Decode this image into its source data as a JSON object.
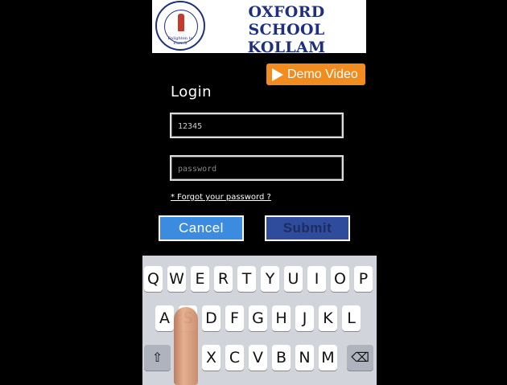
{
  "header": {
    "school_name": "OXFORD SCHOOL KOLLAM",
    "crest_motto": "Enlighten to Enrich",
    "crest_icon": "school-crest-icon"
  },
  "demo": {
    "label": "Demo Video",
    "icon": "play-icon",
    "color": "#f28c1e"
  },
  "login": {
    "title": "Login",
    "username_value": "12345",
    "password_placeholder": "password",
    "forgot_label": "* Forgot your password ?",
    "cancel_label": "Cancel",
    "submit_label": "Submit"
  },
  "keyboard": {
    "row1": [
      "Q",
      "W",
      "E",
      "R",
      "T",
      "Y",
      "U",
      "I",
      "O",
      "P"
    ],
    "row2": [
      "A",
      "S",
      "D",
      "F",
      "G",
      "H",
      "J",
      "K",
      "L"
    ],
    "row3": [
      "X",
      "C",
      "V",
      "B",
      "N",
      "M"
    ],
    "shift_icon": "shift-icon",
    "delete_icon": "backspace-icon"
  }
}
